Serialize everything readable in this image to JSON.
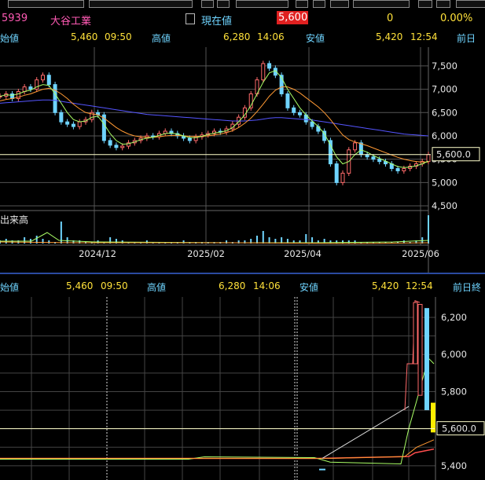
{
  "header": {
    "code": "5939",
    "company": "大谷工業",
    "current_label": "現在値",
    "current_value": "5,600",
    "change": "0",
    "change_pct": "0.00%"
  },
  "stats_top": {
    "open_label": "始値",
    "open_value": "5,460",
    "open_time": "09:50",
    "high_label": "高値",
    "high_value": "6,280",
    "high_time": "14:06",
    "low_label": "安値",
    "low_value": "5,420",
    "low_time": "12:54",
    "prev_label": "前日"
  },
  "stats_bottom": {
    "open_label": "始値",
    "open_value": "5,460",
    "open_time": "09:50",
    "high_label": "高値",
    "high_value": "6,280",
    "high_time": "14:06",
    "low_label": "安値",
    "low_value": "5,420",
    "low_time": "12:54",
    "prev_label": "前日終"
  },
  "colors": {
    "candle_up": "#ff6a6a",
    "candle_down": "#6fd4ff",
    "ma_short": "#aaff66",
    "ma_mid": "#ff9933",
    "ma_long": "#5555ff",
    "price_line": "#ffffcc"
  },
  "chart_data": [
    {
      "type": "candlestick",
      "title": "",
      "y_ticks": [
        "7,500",
        "7,000",
        "6,500",
        "6,000",
        "5,500",
        "5,000",
        "4,500"
      ],
      "y_values": [
        7500,
        7000,
        6500,
        6000,
        5500,
        5000,
        4500
      ],
      "ylim": [
        4450,
        7700
      ],
      "x_ticks": [
        "2024/12",
        "2025/02",
        "2025/04",
        "2025/06"
      ],
      "current_price_label": "5,600.0",
      "current_price": 5600,
      "volume_label": "出来高",
      "close_series": [
        6850,
        6900,
        6800,
        6950,
        7050,
        7000,
        7200,
        7300,
        7100,
        6500,
        6300,
        6250,
        6200,
        6300,
        6350,
        6500,
        6450,
        5900,
        5800,
        5750,
        5780,
        5850,
        5900,
        5950,
        6000,
        5980,
        6050,
        6100,
        6050,
        6000,
        5950,
        5900,
        5980,
        6020,
        6050,
        6100,
        6080,
        6150,
        6250,
        6400,
        6600,
        6900,
        7200,
        7550,
        7450,
        7300,
        6900,
        6600,
        6500,
        6450,
        6300,
        6200,
        6100,
        5900,
        5400,
        5000,
        5200,
        5700,
        5850,
        5600,
        5550,
        5500,
        5450,
        5400,
        5300,
        5250,
        5300,
        5350,
        5400,
        5450,
        5600
      ],
      "ma_short": [
        6850,
        6880,
        6870,
        6900,
        6950,
        6980,
        7050,
        7100,
        7080,
        6900,
        6700,
        6500,
        6350,
        6300,
        6320,
        6400,
        6420,
        6250,
        6050,
        5900,
        5820,
        5830,
        5870,
        5920,
        5950,
        5970,
        6010,
        6050,
        6060,
        6040,
        6000,
        5960,
        5960,
        5990,
        6030,
        6060,
        6080,
        6110,
        6180,
        6300,
        6450,
        6650,
        6900,
        7150,
        7350,
        7400,
        7250,
        7000,
        6800,
        6600,
        6450,
        6320,
        6200,
        6050,
        5800,
        5550,
        5400,
        5450,
        5600,
        5700,
        5650,
        5580,
        5520,
        5460,
        5400,
        5340,
        5320,
        5330,
        5360,
        5400,
        5460
      ],
      "ma_mid": [
        6750,
        6780,
        6800,
        6830,
        6870,
        6900,
        6950,
        7000,
        7020,
        6980,
        6900,
        6800,
        6680,
        6580,
        6500,
        6470,
        6450,
        6380,
        6280,
        6180,
        6100,
        6040,
        6000,
        5980,
        5970,
        5970,
        5980,
        6000,
        6010,
        6010,
        6000,
        5990,
        5985,
        5990,
        6000,
        6020,
        6040,
        6070,
        6110,
        6180,
        6270,
        6380,
        6520,
        6680,
        6850,
        6980,
        7050,
        7050,
        7000,
        6920,
        6820,
        6720,
        6620,
        6500,
        6350,
        6180,
        6020,
        5920,
        5870,
        5830,
        5790,
        5740,
        5690,
        5640,
        5590,
        5540,
        5500,
        5470,
        5450,
        5440,
        5440
      ],
      "ma_long": [
        6700,
        6710,
        6720,
        6730,
        6740,
        6750,
        6760,
        6770,
        6770,
        6760,
        6740,
        6720,
        6700,
        6680,
        6660,
        6640,
        6620,
        6600,
        6580,
        6560,
        6540,
        6520,
        6500,
        6480,
        6460,
        6450,
        6440,
        6430,
        6420,
        6410,
        6400,
        6390,
        6380,
        6370,
        6360,
        6350,
        6340,
        6330,
        6320,
        6320,
        6320,
        6330,
        6340,
        6360,
        6380,
        6390,
        6390,
        6380,
        6370,
        6360,
        6350,
        6340,
        6320,
        6300,
        6280,
        6260,
        6240,
        6220,
        6200,
        6180,
        6160,
        6140,
        6120,
        6100,
        6080,
        6060,
        6040,
        6030,
        6020,
        6010,
        6000
      ]
    },
    {
      "type": "candlestick",
      "title": "",
      "y_ticks": [
        "6,200",
        "6,000",
        "5,800",
        "5,400"
      ],
      "y_values": [
        6200,
        6000,
        5800,
        5400
      ],
      "ylim": [
        5370,
        6310
      ],
      "current_price_label": "5,600.0",
      "current_price": 5600
    }
  ]
}
